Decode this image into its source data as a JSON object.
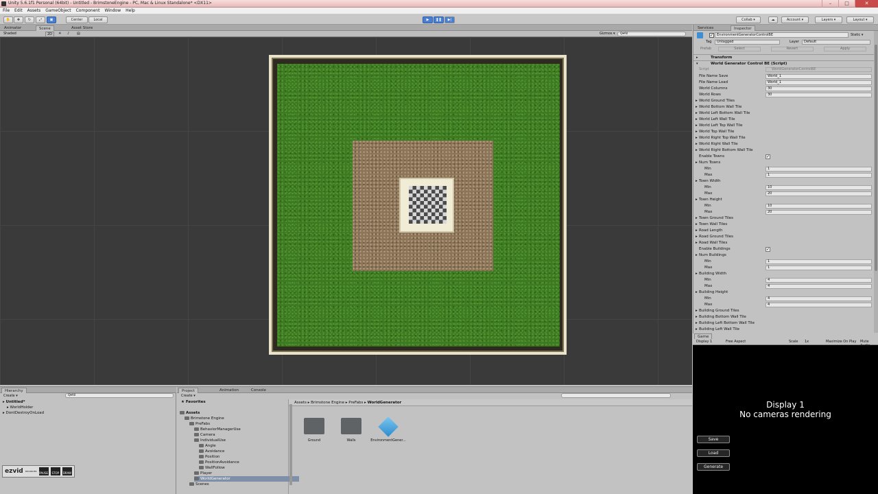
{
  "window": {
    "title": "Unity 5.6.1f1 Personal (64bit) - Untitled - BrimstoneEngine - PC, Mac & Linux Standalone* <DX11>"
  },
  "menu": [
    "File",
    "Edit",
    "Assets",
    "GameObject",
    "Component",
    "Window",
    "Help"
  ],
  "toolbar": {
    "pivot_center": "Center",
    "pivot_local": "Local",
    "collab": "Collab ▾",
    "account": "Account ▾",
    "layers": "Layers ▾",
    "layout": "Layout ▾"
  },
  "scene_tabs": {
    "animator": "Animator",
    "scene": "Scene",
    "asset_store": "Asset Store"
  },
  "scene_bar": {
    "shading": "Shaded",
    "mode2d": "2D",
    "gizmos": "Gizmos ▾",
    "search": "Q▾All"
  },
  "right_tabs": {
    "services": "Services",
    "inspector": "Inspector"
  },
  "inspector": {
    "object_name": "EnvironmentGeneratorControlBE",
    "static_label": "Static ▾",
    "tag_label": "Tag",
    "tag_value": "Untagged",
    "layer_label": "Layer",
    "layer_value": "Default",
    "prefab_label": "Prefab",
    "select": "Select",
    "revert": "Revert",
    "apply": "Apply",
    "transform": "Transform",
    "script_component": "World Generator Control BE (Script)",
    "script_label": "Script",
    "script_value": "WorldGeneratorControlBE",
    "rows": [
      {
        "label": "File Name Save",
        "value": "World_1",
        "type": "field"
      },
      {
        "label": "File Name Load",
        "value": "World_1",
        "type": "field"
      },
      {
        "label": "World Columns",
        "value": "30",
        "type": "field"
      },
      {
        "label": "World Rows",
        "value": "30",
        "type": "field"
      },
      {
        "label": "World Ground Tiles",
        "value": "",
        "type": "fold"
      },
      {
        "label": "World Bottom Wall Tile",
        "value": "",
        "type": "fold"
      },
      {
        "label": "World Left Bottom Wall Tile",
        "value": "",
        "type": "fold"
      },
      {
        "label": "World Left Wall Tile",
        "value": "",
        "type": "fold"
      },
      {
        "label": "World Left Top Wall Tile",
        "value": "",
        "type": "fold"
      },
      {
        "label": "World Top Wall Tile",
        "value": "",
        "type": "fold"
      },
      {
        "label": "World Right Top Wall Tile",
        "value": "",
        "type": "fold"
      },
      {
        "label": "World Right Wall Tile",
        "value": "",
        "type": "fold"
      },
      {
        "label": "World Right Bottom Wall Tile",
        "value": "",
        "type": "fold"
      },
      {
        "label": "Enable Towns",
        "value": "✓",
        "type": "check"
      },
      {
        "label": "Num Towns",
        "value": "",
        "type": "fold"
      },
      {
        "label": "Min",
        "value": "1",
        "type": "sub"
      },
      {
        "label": "Max",
        "value": "1",
        "type": "sub"
      },
      {
        "label": "Town Width",
        "value": "",
        "type": "fold"
      },
      {
        "label": "Min",
        "value": "10",
        "type": "sub"
      },
      {
        "label": "Max",
        "value": "20",
        "type": "sub"
      },
      {
        "label": "Town Height",
        "value": "",
        "type": "fold"
      },
      {
        "label": "Min",
        "value": "10",
        "type": "sub"
      },
      {
        "label": "Max",
        "value": "20",
        "type": "sub"
      },
      {
        "label": "Town Ground Tiles",
        "value": "",
        "type": "fold"
      },
      {
        "label": "Town Wall Tiles",
        "value": "",
        "type": "fold"
      },
      {
        "label": "Road Length",
        "value": "",
        "type": "fold"
      },
      {
        "label": "Road Ground Tiles",
        "value": "",
        "type": "fold"
      },
      {
        "label": "Road Wall Tiles",
        "value": "",
        "type": "fold"
      },
      {
        "label": "Enable Buildings",
        "value": "✓",
        "type": "check"
      },
      {
        "label": "Num Buildings",
        "value": "",
        "type": "fold"
      },
      {
        "label": "Min",
        "value": "1",
        "type": "sub"
      },
      {
        "label": "Max",
        "value": "1",
        "type": "sub"
      },
      {
        "label": "Building Width",
        "value": "",
        "type": "fold"
      },
      {
        "label": "Min",
        "value": "4",
        "type": "sub"
      },
      {
        "label": "Max",
        "value": "4",
        "type": "sub"
      },
      {
        "label": "Building Height",
        "value": "",
        "type": "fold"
      },
      {
        "label": "Min",
        "value": "4",
        "type": "sub"
      },
      {
        "label": "Max",
        "value": "4",
        "type": "sub"
      },
      {
        "label": "Building Ground Tiles",
        "value": "",
        "type": "fold"
      },
      {
        "label": "Building Bottom Wall Tile",
        "value": "",
        "type": "fold"
      },
      {
        "label": "Building Left Bottom Wall Tile",
        "value": "",
        "type": "fold"
      },
      {
        "label": "Building Left Wall Tile",
        "value": "",
        "type": "fold"
      }
    ]
  },
  "game": {
    "tab": "Game",
    "display": "Display 1",
    "aspect": "Free Aspect",
    "scale_label": "Scale",
    "scale_value": "1x",
    "maximize": "Maximize On Play",
    "mute": "Mute Audio",
    "msg_line1": "Display 1",
    "msg_line2": "No cameras rendering",
    "buttons": [
      "Save",
      "Load",
      "Generate"
    ]
  },
  "hierarchy": {
    "tab": "Hierarchy",
    "create": "Create ▾",
    "search": "Q▾All",
    "items": [
      {
        "label": "Untitled*",
        "indent": 0
      },
      {
        "label": "WorldHolder",
        "indent": 1
      },
      {
        "label": "DontDestroyOnLoad",
        "indent": 0
      }
    ]
  },
  "project": {
    "tabs": [
      "Project",
      "Animation",
      "Console"
    ],
    "create": "Create ▾",
    "favorites": "Favorites",
    "tree": [
      {
        "label": "Assets",
        "indent": 0
      },
      {
        "label": "Brimstone Engine",
        "indent": 1
      },
      {
        "label": "PreFabs",
        "indent": 2
      },
      {
        "label": "BehaviorManagerUse",
        "indent": 3
      },
      {
        "label": "Camera",
        "indent": 3
      },
      {
        "label": "IndividualUse",
        "indent": 3
      },
      {
        "label": "Angle",
        "indent": 4
      },
      {
        "label": "Avoidance",
        "indent": 4
      },
      {
        "label": "Position",
        "indent": 4
      },
      {
        "label": "PositionAvoidance",
        "indent": 4
      },
      {
        "label": "WallFollow",
        "indent": 4
      },
      {
        "label": "Player",
        "indent": 3
      },
      {
        "label": "WorldGenerator",
        "indent": 3
      },
      {
        "label": "Scenes",
        "indent": 2
      }
    ],
    "breadcrumb": [
      "Assets",
      "Brimstone Engine",
      "PreFabs",
      "WorldGenerator"
    ],
    "assets": [
      {
        "label": "Ground",
        "kind": "folder"
      },
      {
        "label": "Walls",
        "kind": "folder"
      },
      {
        "label": "EnvironmentGener...",
        "kind": "prefab"
      }
    ]
  },
  "recorder": {
    "logo": "ezvid",
    "sub": "RECORDER",
    "pause": "PAUSE",
    "stop": "STOP",
    "draw": "DRAW"
  }
}
